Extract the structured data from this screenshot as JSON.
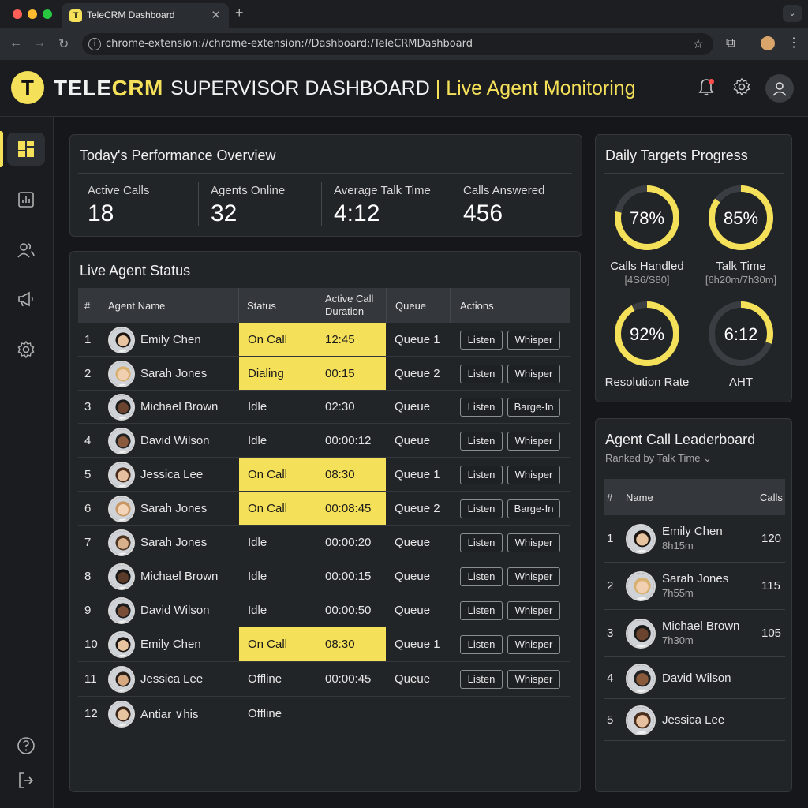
{
  "browser": {
    "tab_title": "TeleCRM Dashboard",
    "url": "chrome-extension://chrome-extension://Dashboard:/TeleCRMDashboard"
  },
  "header": {
    "logo_tele": "TELE",
    "logo_crm": "CRM",
    "title": "SUPERVISOR DASHBOARD",
    "separator": " | ",
    "subtitle": "Live Agent Monitoring"
  },
  "overview": {
    "title": "Today's Performance Overview",
    "kpis": [
      {
        "label": "Active Calls",
        "value": "18"
      },
      {
        "label": "Agents Online",
        "value": "32"
      },
      {
        "label": "Average Talk Time",
        "value": "4:12"
      },
      {
        "label": "Calls Answered",
        "value": "456"
      }
    ]
  },
  "agent_status": {
    "title": "Live Agent Status",
    "columns": [
      "#",
      "Agent Name",
      "Status",
      "Active Call Duration",
      "Queue",
      "Actions"
    ],
    "rows": [
      {
        "num": "1",
        "name": "Emily Chen",
        "status": "On Call",
        "duration": "12:45",
        "queue": "Queue 1",
        "action1": "Listen",
        "action2": "Whisper",
        "highlight": true
      },
      {
        "num": "2",
        "name": "Sarah Jones",
        "status": "Dialing",
        "duration": "00:15",
        "queue": "Queue 2",
        "action1": "Listen",
        "action2": "Whisper",
        "highlight": true
      },
      {
        "num": "3",
        "name": "Michael Brown",
        "status": "Idle",
        "duration": "02:30",
        "queue": "Queue",
        "action1": "Listen",
        "action2": "Barge-In",
        "highlight": false
      },
      {
        "num": "4",
        "name": "David Wilson",
        "status": "Idle",
        "duration": "00:00:12",
        "queue": "Queue",
        "action1": "Listen",
        "action2": "Whisper",
        "highlight": false
      },
      {
        "num": "5",
        "name": "Jessica Lee",
        "status": "On Call",
        "duration": "08:30",
        "queue": "Queue 1",
        "action1": "Listen",
        "action2": "Whisper",
        "highlight": true
      },
      {
        "num": "6",
        "name": "Sarah Jones",
        "status": "On Call",
        "duration": "00:08:45",
        "queue": "Queue 2",
        "action1": "Listen",
        "action2": "Barge-In",
        "highlight": true
      },
      {
        "num": "7",
        "name": "Sarah Jones",
        "status": "Idle",
        "duration": "00:00:20",
        "queue": "Queue",
        "action1": "Listen",
        "action2": "Whisper",
        "highlight": false
      },
      {
        "num": "8",
        "name": "Michael Brown",
        "status": "Idle",
        "duration": "00:00:15",
        "queue": "Queue",
        "action1": "Listen",
        "action2": "Whisper",
        "highlight": false
      },
      {
        "num": "9",
        "name": "David Wilson",
        "status": "Idle",
        "duration": "00:00:50",
        "queue": "Queue",
        "action1": "Listen",
        "action2": "Whisper",
        "highlight": false
      },
      {
        "num": "10",
        "name": "Emily Chen",
        "status": "On Call",
        "duration": "08:30",
        "queue": "Queue 1",
        "action1": "Listen",
        "action2": "Whisper",
        "highlight": true
      },
      {
        "num": "11",
        "name": "Jessica Lee",
        "status": "Offline",
        "duration": "00:00:45",
        "queue": "Queue",
        "action1": "Listen",
        "action2": "Whisper",
        "highlight": false
      },
      {
        "num": "12",
        "name": "Antiar ∨his",
        "status": "Offline",
        "duration": "",
        "queue": "",
        "action1": "",
        "action2": "",
        "highlight": false
      }
    ]
  },
  "targets": {
    "title": "Daily Targets Progress",
    "gauges": [
      {
        "value_text": "78%",
        "fraction": 0.78,
        "label": "Calls Handled",
        "sub": "[4S6/S80]"
      },
      {
        "value_text": "85%",
        "fraction": 0.85,
        "label": "Talk Time",
        "sub": "[6h20m/7h30m]"
      },
      {
        "value_text": "92%",
        "fraction": 0.92,
        "label": "Resolution Rate",
        "sub": ""
      },
      {
        "value_text": "6:12",
        "fraction": 0.3,
        "label": "AHT",
        "sub": ""
      }
    ]
  },
  "leaderboard": {
    "title": "Agent Call Leaderboard",
    "sort_label": "Ranked by Talk Time",
    "columns": [
      "#",
      "Name",
      "Calls"
    ],
    "rows": [
      {
        "rank": "1",
        "name": "Emily Chen",
        "time": "8h15m",
        "calls": "120"
      },
      {
        "rank": "2",
        "name": "Sarah Jones",
        "time": "7h55m",
        "calls": "115"
      },
      {
        "rank": "3",
        "name": "Michael Brown",
        "time": "7h30m",
        "calls": "105"
      },
      {
        "rank": "4",
        "name": "David Wilson",
        "time": "",
        "calls": ""
      },
      {
        "rank": "5",
        "name": "Jessica Lee",
        "time": "",
        "calls": ""
      }
    ]
  },
  "colors": {
    "accent": "#f5e05a",
    "background": "#15171a",
    "panel": "#222528"
  },
  "icons": {
    "sidebar": [
      "dashboard-icon",
      "reports-icon",
      "users-icon",
      "campaigns-icon",
      "settings-icon",
      "help-icon",
      "logout-icon"
    ],
    "header": [
      "bell-icon",
      "gear-icon",
      "user-icon"
    ]
  }
}
